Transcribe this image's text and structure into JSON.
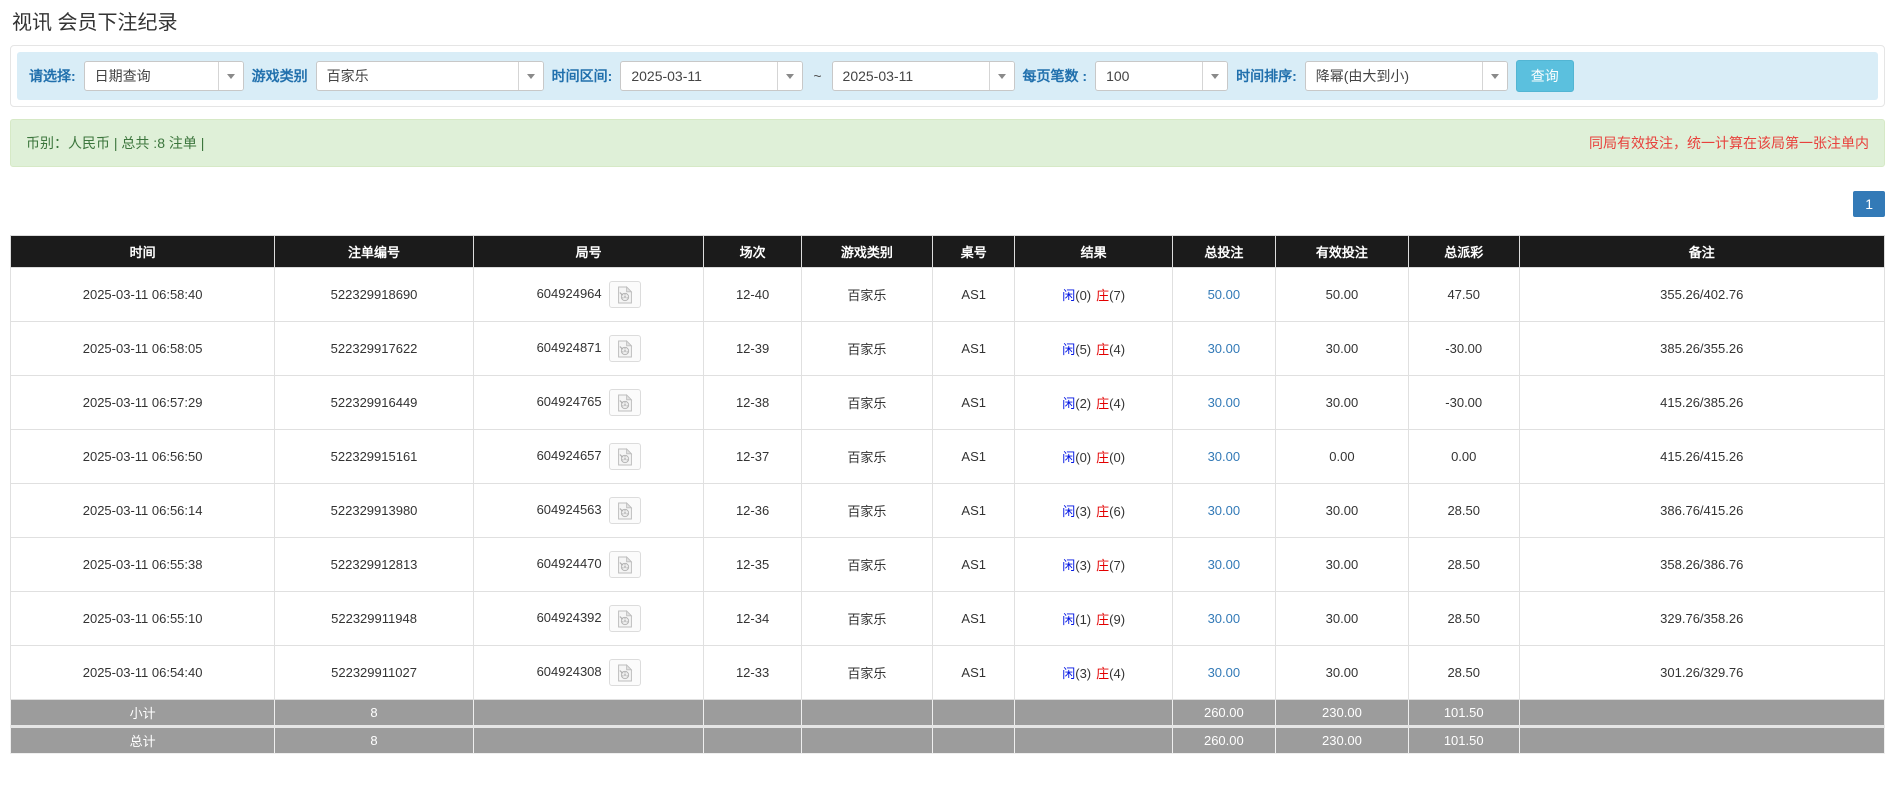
{
  "page": {
    "title": "视讯 会员下注纪录"
  },
  "filters": {
    "select_label": "请选择:",
    "select_value": "日期查询",
    "game_type_label": "游戏类别",
    "game_type_value": "百家乐",
    "time_range_label": "时间区间:",
    "date_from": "2025-03-11",
    "range_separator": "~",
    "date_to": "2025-03-11",
    "page_size_label": "每页笔数 :",
    "page_size_value": "100",
    "sort_label": "时间排序:",
    "sort_value": "降幂(由大到小)",
    "search_button": "查询"
  },
  "summary_bar": {
    "left_text": "币别：人民币 | 总共 :8 注单 |",
    "right_notice": "同局有效投注，统一计算在该局第一张注单内"
  },
  "pagination": {
    "current_page": "1"
  },
  "table": {
    "headers": [
      "时间",
      "注单编号",
      "局号",
      "场次",
      "游戏类别",
      "桌号",
      "结果",
      "总投注",
      "有效投注",
      "总派彩",
      "备注"
    ],
    "rows": [
      {
        "time": "2025-03-11 06:58:40",
        "bet_no": "522329918690",
        "round_no": "604924964",
        "session": "12-40",
        "game": "百家乐",
        "table_no": "AS1",
        "player_label": "闲",
        "player_score": "(0)",
        "banker_label": "庄",
        "banker_score": "(7)",
        "total_bet": "50.00",
        "valid_bet": "50.00",
        "payout": "47.50",
        "remark": "355.26/402.76"
      },
      {
        "time": "2025-03-11 06:58:05",
        "bet_no": "522329917622",
        "round_no": "604924871",
        "session": "12-39",
        "game": "百家乐",
        "table_no": "AS1",
        "player_label": "闲",
        "player_score": "(5)",
        "banker_label": "庄",
        "banker_score": "(4)",
        "total_bet": "30.00",
        "valid_bet": "30.00",
        "payout": "-30.00",
        "remark": "385.26/355.26"
      },
      {
        "time": "2025-03-11 06:57:29",
        "bet_no": "522329916449",
        "round_no": "604924765",
        "session": "12-38",
        "game": "百家乐",
        "table_no": "AS1",
        "player_label": "闲",
        "player_score": "(2)",
        "banker_label": "庄",
        "banker_score": "(4)",
        "total_bet": "30.00",
        "valid_bet": "30.00",
        "payout": "-30.00",
        "remark": "415.26/385.26"
      },
      {
        "time": "2025-03-11 06:56:50",
        "bet_no": "522329915161",
        "round_no": "604924657",
        "session": "12-37",
        "game": "百家乐",
        "table_no": "AS1",
        "player_label": "闲",
        "player_score": "(0)",
        "banker_label": "庄",
        "banker_score": "(0)",
        "total_bet": "30.00",
        "valid_bet": "0.00",
        "payout": "0.00",
        "remark": "415.26/415.26"
      },
      {
        "time": "2025-03-11 06:56:14",
        "bet_no": "522329913980",
        "round_no": "604924563",
        "session": "12-36",
        "game": "百家乐",
        "table_no": "AS1",
        "player_label": "闲",
        "player_score": "(3)",
        "banker_label": "庄",
        "banker_score": "(6)",
        "total_bet": "30.00",
        "valid_bet": "30.00",
        "payout": "28.50",
        "remark": "386.76/415.26"
      },
      {
        "time": "2025-03-11 06:55:38",
        "bet_no": "522329912813",
        "round_no": "604924470",
        "session": "12-35",
        "game": "百家乐",
        "table_no": "AS1",
        "player_label": "闲",
        "player_score": "(3)",
        "banker_label": "庄",
        "banker_score": "(7)",
        "total_bet": "30.00",
        "valid_bet": "30.00",
        "payout": "28.50",
        "remark": "358.26/386.76"
      },
      {
        "time": "2025-03-11 06:55:10",
        "bet_no": "522329911948",
        "round_no": "604924392",
        "session": "12-34",
        "game": "百家乐",
        "table_no": "AS1",
        "player_label": "闲",
        "player_score": "(1)",
        "banker_label": "庄",
        "banker_score": "(9)",
        "total_bet": "30.00",
        "valid_bet": "30.00",
        "payout": "28.50",
        "remark": "329.76/358.26"
      },
      {
        "time": "2025-03-11 06:54:40",
        "bet_no": "522329911027",
        "round_no": "604924308",
        "session": "12-33",
        "game": "百家乐",
        "table_no": "AS1",
        "player_label": "闲",
        "player_score": "(3)",
        "banker_label": "庄",
        "banker_score": "(4)",
        "total_bet": "30.00",
        "valid_bet": "30.00",
        "payout": "28.50",
        "remark": "301.26/329.76"
      }
    ],
    "subtotal": {
      "label": "小计",
      "count": "8",
      "total_bet": "260.00",
      "valid_bet": "230.00",
      "payout": "101.50"
    },
    "total": {
      "label": "总计",
      "count": "8",
      "total_bet": "260.00",
      "valid_bet": "230.00",
      "payout": "101.50"
    }
  },
  "colors": {
    "label_blue": "#2170ad",
    "search_button_blue": "#5bc0de",
    "green_bar_bg": "#dff0d8",
    "green_text": "#3c763d",
    "notice_red": "#e8413c",
    "pagination_blue": "#337ab7",
    "header_bg": "#1b1b1b",
    "player_blue": "#0014e3",
    "banker_red": "#e30000",
    "bet_link_blue": "#337ab7",
    "negative_red": "#e60000",
    "summary_row_gray": "#9c9c9c"
  }
}
